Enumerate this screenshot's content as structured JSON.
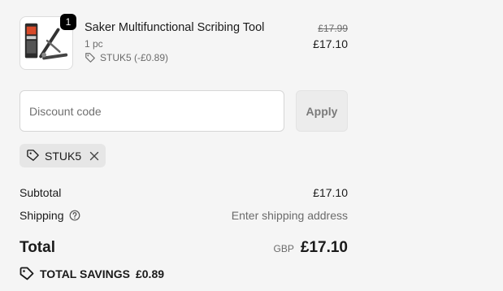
{
  "product": {
    "quantity_badge": "1",
    "name": "Saker Multifunctional Scribing Tool",
    "quantity_text": "1 pc",
    "discount_text": "STUK5 (-£0.89)",
    "original_price": "£17.99",
    "price": "£17.10",
    "image_icon": "scribing-tool-product-image"
  },
  "discount": {
    "placeholder": "Discount code",
    "value": "",
    "apply_label": "Apply",
    "applied_code": "STUK5"
  },
  "summary": {
    "subtotal_label": "Subtotal",
    "subtotal_value": "£17.10",
    "shipping_label": "Shipping",
    "shipping_value": "Enter shipping address",
    "total_label": "Total",
    "currency": "GBP",
    "total_value": "£17.10",
    "savings_label": "TOTAL SAVINGS",
    "savings_value": "£0.89"
  },
  "colors": {
    "background": "#f5f5f5",
    "text": "#1a1a1a",
    "muted": "#6b6b6b",
    "badge": "#000000"
  }
}
